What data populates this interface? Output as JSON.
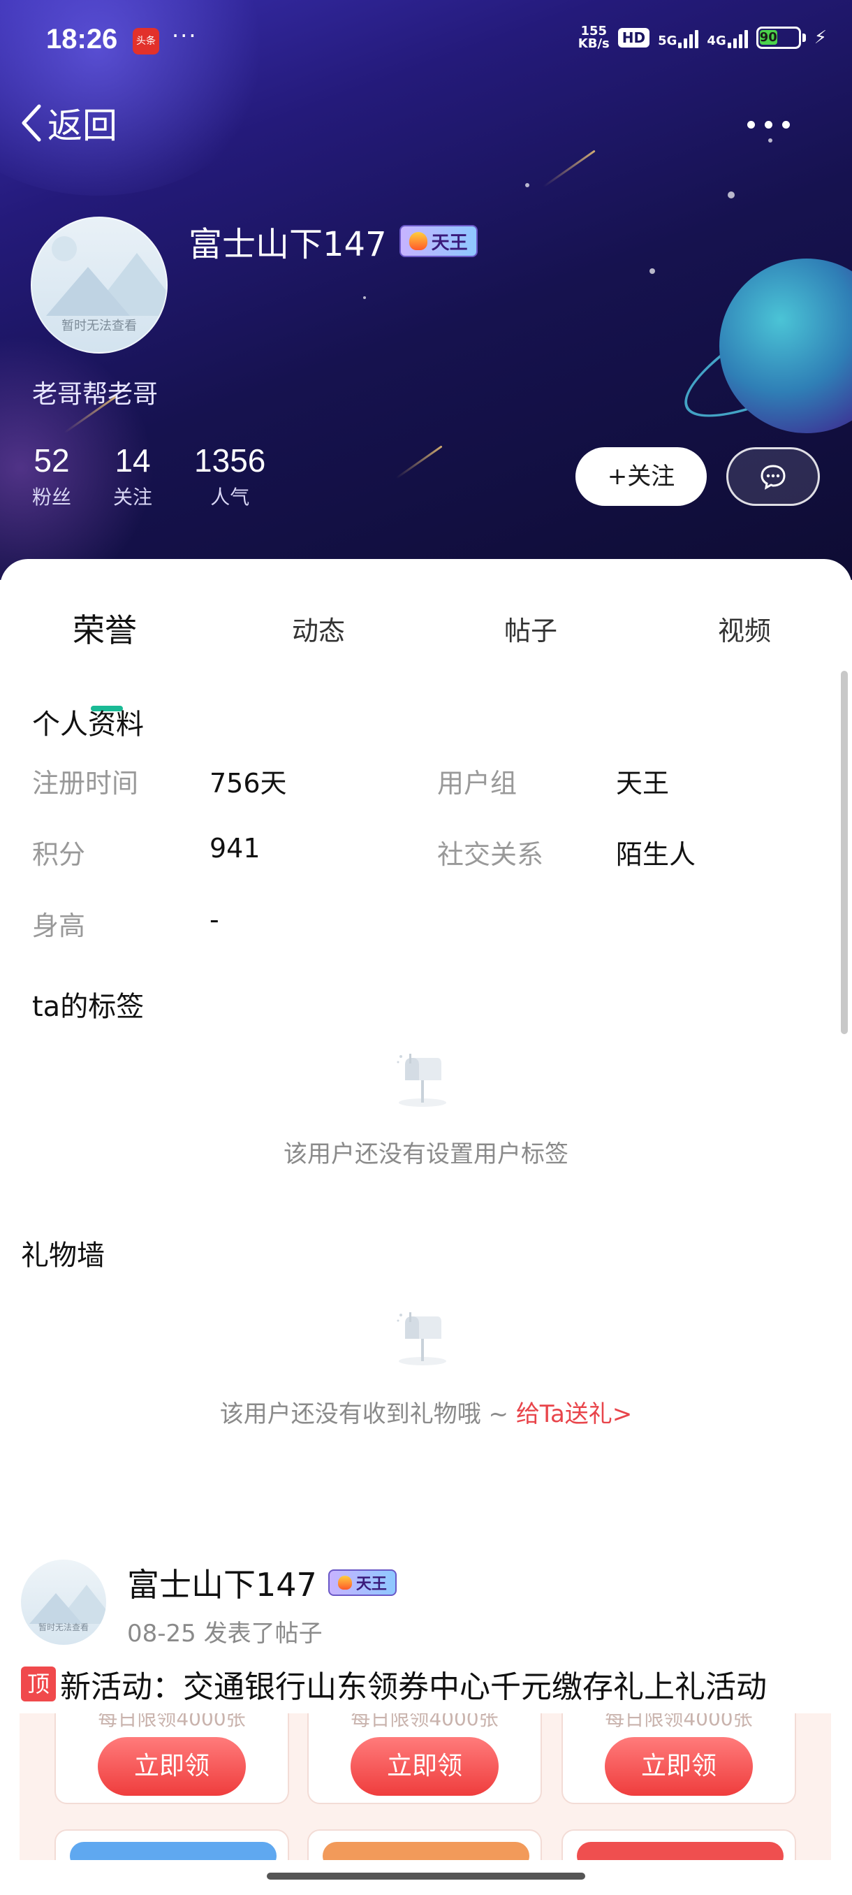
{
  "status_bar": {
    "time": "18:26",
    "app_badge": "头条",
    "dots": "···",
    "net_speed_top": "155",
    "net_speed_bottom": "KB/s",
    "hd": "HD",
    "net1": "5G",
    "net2": "4G",
    "battery": "90"
  },
  "nav": {
    "back_label": "返回"
  },
  "profile": {
    "avatar_placeholder": "暂时无法查看",
    "username": "富士山下147",
    "badge": "天王",
    "bio": "老哥帮老哥",
    "stats": [
      {
        "value": "52",
        "label": "粉丝"
      },
      {
        "value": "14",
        "label": "关注"
      },
      {
        "value": "1356",
        "label": "人气"
      }
    ],
    "follow_label": "+关注"
  },
  "tabs": [
    "荣誉",
    "动态",
    "帖子",
    "视频"
  ],
  "personal_info": {
    "title": "个人资料",
    "rows": [
      {
        "k1": "注册时间",
        "v1": "756天",
        "k2": "用户组",
        "v2": "天王"
      },
      {
        "k1": "积分",
        "v1": "941",
        "k2": "社交关系",
        "v2": "陌生人"
      },
      {
        "k1": "身高",
        "v1": "-"
      }
    ]
  },
  "tags": {
    "title": "ta的标签",
    "empty_text": "该用户还没有设置用户标签"
  },
  "gifts": {
    "title": "礼物墙",
    "empty_text": "该用户还没有收到礼物哦 ~ ",
    "link_text": "给Ta送礼>"
  },
  "post": {
    "username": "富士山下147",
    "badge": "天王",
    "avatar_placeholder": "暂时无法查看",
    "meta": "08-25 发表了帖子",
    "pin": "顶",
    "title": "新活动：交通银行山东领券中心千元缴存礼上礼活动",
    "coupon_sub": "每日限领4000张",
    "coupon_button": "立即领"
  },
  "colors": {
    "accent": "#1aba95",
    "link": "#e8444a",
    "pin": "#f0494c"
  }
}
